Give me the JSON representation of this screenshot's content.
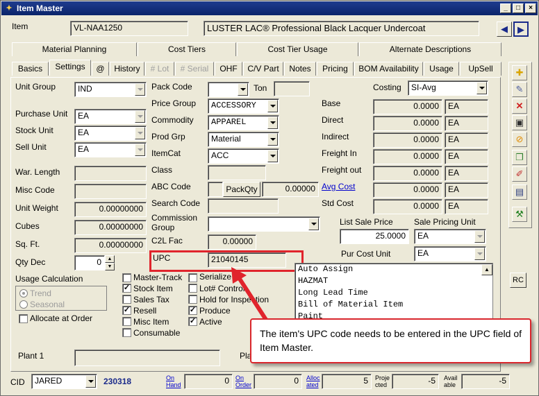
{
  "window": {
    "title": "Item Master"
  },
  "header": {
    "item_label": "Item",
    "item_code": "VL-NAA1250",
    "item_desc": "LUSTER LAC® Professional Black Lacquer Undercoat"
  },
  "tabs_top": [
    "Material Planning",
    "Cost Tiers",
    "Cost Tier Usage",
    "Alternate Descriptions"
  ],
  "tabs_main": [
    "Basics",
    "Settings",
    "@",
    "History",
    "# Lot",
    "# Serial",
    "OHF",
    "C/V Part",
    "Notes",
    "Pricing",
    "BOM Availability",
    "Usage",
    "UpSell"
  ],
  "left": {
    "unit_group_label": "Unit Group",
    "unit_group": "IND",
    "purchase_unit_label": "Purchase Unit",
    "purchase_unit": "EA",
    "stock_unit_label": "Stock Unit",
    "stock_unit": "EA",
    "sell_unit_label": "Sell Unit",
    "sell_unit": "EA",
    "war_length_label": "War. Length",
    "misc_code_label": "Misc Code",
    "unit_weight_label": "Unit Weight",
    "unit_weight": "0.00000000",
    "cubes_label": "Cubes",
    "cubes": "0.00000000",
    "sqft_label": "Sq. Ft.",
    "sqft": "0.00000000",
    "qty_dec_label": "Qty Dec",
    "qty_dec": "0",
    "usage_calc_label": "Usage Calculation",
    "trend": "Trend",
    "seasonal": "Seasonal",
    "allocate_label": "Allocate at Order",
    "plant_label": "Plant 1"
  },
  "middle": {
    "pack_code_label": "Pack Code",
    "ton_label": "Ton",
    "price_group_label": "Price Group",
    "price_group": "ACCESSORY",
    "commodity_label": "Commodity",
    "commodity": "APPAREL",
    "prod_grp_label": "Prod Grp",
    "prod_grp": "Material",
    "itemcat_label": "ItemCat",
    "itemcat": "ACC",
    "class_label": "Class",
    "abc_code_label": "ABC Code",
    "packqty_button": "PackQty",
    "packqty": "0.00000",
    "search_code_label": "Search Code",
    "commission_label": "Commission Group",
    "c2l_label": "C2L Fac",
    "c2l": "0.00000",
    "upc_label": "UPC",
    "upc": "21040145",
    "plant2_label": "Pla"
  },
  "checkboxes_col1": [
    {
      "label": "Master-Track",
      "checked": false
    },
    {
      "label": "Stock Item",
      "checked": true
    },
    {
      "label": "Sales Tax",
      "checked": false
    },
    {
      "label": "Resell",
      "checked": true
    },
    {
      "label": "Misc Item",
      "checked": false
    },
    {
      "label": "Consumable",
      "checked": false
    }
  ],
  "checkboxes_col2": [
    {
      "label": "Serialize",
      "checked": false
    },
    {
      "label": "Lot# Control",
      "checked": false
    },
    {
      "label": "Hold for Inspection",
      "checked": false
    },
    {
      "label": "Produce",
      "checked": true
    },
    {
      "label": "Active",
      "checked": true
    }
  ],
  "right": {
    "costing_label": "Costing",
    "costing": "SI-Avg",
    "rows": [
      {
        "label": "Base",
        "value": "0.0000",
        "unit": "EA"
      },
      {
        "label": "Direct",
        "value": "0.0000",
        "unit": "EA"
      },
      {
        "label": "Indirect",
        "value": "0.0000",
        "unit": "EA"
      },
      {
        "label": "Freight In",
        "value": "0.0000",
        "unit": "EA"
      },
      {
        "label": "Freight out",
        "value": "0.0000",
        "unit": "EA"
      },
      {
        "label": "Avg Cost",
        "value": "0.0000",
        "unit": "EA"
      },
      {
        "label": "Std Cost",
        "value": "0.0000",
        "unit": "EA"
      }
    ],
    "list_sale_price_label": "List Sale Price",
    "list_sale_price": "25.0000",
    "sale_pricing_unit_label": "Sale Pricing Unit",
    "sale_pricing_unit": "EA",
    "pur_cost_unit_label": "Pur Cost Unit",
    "pur_cost_unit": "EA"
  },
  "listbox": [
    "Auto Assign",
    "HAZMAT",
    "Long Lead Time",
    "Bill of Material Item",
    "Paint"
  ],
  "footer": {
    "cid_label": "CID",
    "cid": "JARED",
    "cid_num": "230318",
    "on_hand_label": "On Hand",
    "on_hand": "0",
    "on_order_label": "On Order",
    "on_order": "0",
    "allocated_label": "Alloc ated",
    "allocated": "5",
    "projected_label": "Proje cted",
    "projected": "-5",
    "available_label": "Avail able",
    "available": "-5"
  },
  "toolbar": {
    "rc_label": "RC"
  },
  "callout": {
    "text": "The item's UPC code needs to be entered in the UPC field of Item Master."
  }
}
